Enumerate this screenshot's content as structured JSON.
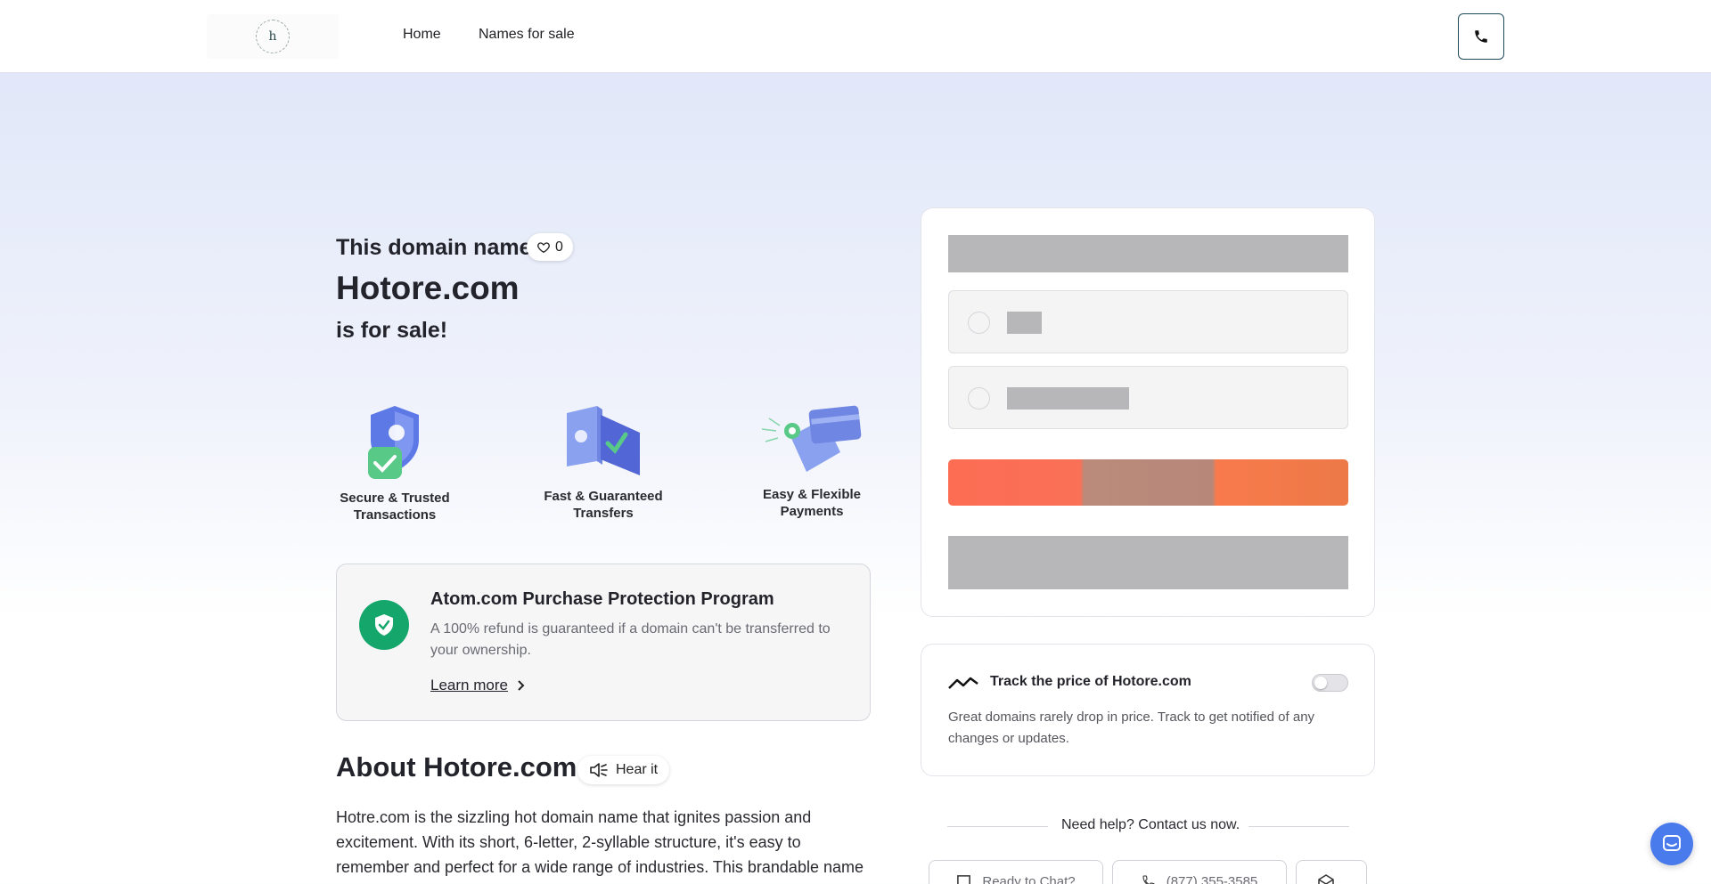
{
  "header": {
    "logo_text": "h",
    "nav": [
      {
        "label": "Home"
      },
      {
        "label": "Names for sale"
      }
    ]
  },
  "hero": {
    "line1": "This domain name",
    "like_count": "0",
    "domain": "Hotore.com",
    "line3": "is for sale!"
  },
  "features": [
    {
      "label": "Secure & Trusted Transactions",
      "icon": "shield-check-icon"
    },
    {
      "label": "Fast & Guaranteed Transfers",
      "icon": "transfer-folder-icon"
    },
    {
      "label": "Easy & Flexible Payments",
      "icon": "payment-cards-icon"
    }
  ],
  "protection": {
    "title": "Atom.com Purchase Protection Program",
    "text": "A 100% refund is guaranteed if a domain can't be transferred to your ownership.",
    "link": "Learn more"
  },
  "about": {
    "title": "About Hotore.com",
    "hear_label": "Hear it",
    "text": "Hotre.com is the sizzling hot domain name that ignites passion and excitement. With its short, 6-letter, 2-syllable structure, it's easy to remember and perfect for a wide range of industries. This brandable name exudes a"
  },
  "track": {
    "title": "Track the price of Hotore.com",
    "text": "Great domains rarely drop in price. Track to get notified of any changes or updates.",
    "enabled": false
  },
  "help": {
    "title": "Need help? Contact us now.",
    "buttons": [
      {
        "label": "Ready to Chat?",
        "icon": "chat-icon"
      },
      {
        "label": "(877) 355-3585",
        "icon": "phone-icon"
      },
      {
        "label": "",
        "icon": "mail-icon"
      }
    ]
  },
  "colors": {
    "accent_green": "#14a66b",
    "cta_orange": "#fd6d54",
    "chat_blue": "#4a7bec",
    "phone_border": "#1e4b5c"
  }
}
